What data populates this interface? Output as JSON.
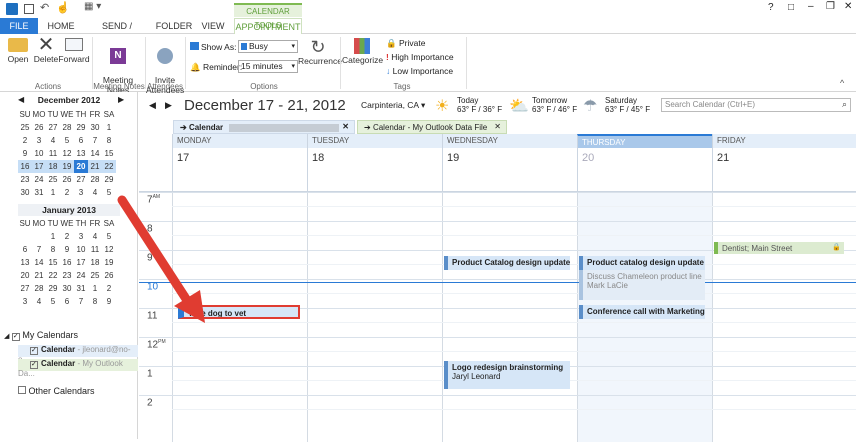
{
  "titlebar": {
    "controls": [
      "?",
      "□",
      "–",
      "❐",
      "✕"
    ]
  },
  "tabs": {
    "file": "FILE",
    "home": "HOME",
    "send_receive": "SEND / RECEIVE",
    "folder": "FOLDER",
    "view": "VIEW",
    "context": "CALENDAR TOOLS",
    "appointment": "APPOINTMENT"
  },
  "ribbon": {
    "open": "Open",
    "delete": "Delete",
    "forward": "Forward",
    "actions": "Actions",
    "meeting_notes": "Meeting\nNotes",
    "meeting_notes_group": "Meeting Notes",
    "invite": "Invite\nAttendees",
    "attendees": "Attendees",
    "show_as_label": "Show As:",
    "show_as_value": "Busy",
    "reminder_label": "Reminder:",
    "reminder_value": "15 minutes",
    "recurrence": "Recurrence",
    "options": "Options",
    "categorize": "Categorize",
    "private": "Private",
    "high": "High Importance",
    "low": "Low Importance",
    "tags": "Tags"
  },
  "mini1": {
    "title": "December 2012",
    "dow": [
      "SU",
      "MO",
      "TU",
      "WE",
      "TH",
      "FR",
      "SA"
    ],
    "rows": [
      [
        "25",
        "26",
        "27",
        "28",
        "29",
        "30",
        "1"
      ],
      [
        "2",
        "3",
        "4",
        "5",
        "6",
        "7",
        "8"
      ],
      [
        "9",
        "10",
        "11",
        "12",
        "13",
        "14",
        "15"
      ],
      [
        "16",
        "17",
        "18",
        "19",
        "20",
        "21",
        "22"
      ],
      [
        "23",
        "24",
        "25",
        "26",
        "27",
        "28",
        "29"
      ],
      [
        "30",
        "31",
        "1",
        "2",
        "3",
        "4",
        "5"
      ]
    ]
  },
  "mini2": {
    "title": "January 2013",
    "dow": [
      "SU",
      "MO",
      "TU",
      "WE",
      "TH",
      "FR",
      "SA"
    ],
    "rows": [
      [
        "",
        "",
        "1",
        "2",
        "3",
        "4",
        "5"
      ],
      [
        "6",
        "7",
        "8",
        "9",
        "10",
        "11",
        "12"
      ],
      [
        "13",
        "14",
        "15",
        "16",
        "17",
        "18",
        "19"
      ],
      [
        "20",
        "21",
        "22",
        "23",
        "24",
        "25",
        "26"
      ],
      [
        "27",
        "28",
        "29",
        "30",
        "31",
        "1",
        "2"
      ],
      [
        "3",
        "4",
        "5",
        "6",
        "7",
        "8",
        "9"
      ]
    ]
  },
  "folders": {
    "my_calendars": "My Calendars",
    "cal1": "Calendar",
    "cal1_sub": "- jleonard@no-o...",
    "cal2": "Calendar",
    "cal2_sub": "- My Outlook Da...",
    "other": "Other Calendars"
  },
  "header": {
    "range": "December 17 - 21, 2012",
    "location": "Carpinteria, CA",
    "today": "Today",
    "today_temp": "63° F / 36° F",
    "tomorrow": "Tomorrow",
    "tomorrow_temp": "63° F / 46° F",
    "saturday": "Saturday",
    "saturday_temp": "63° F / 45° F",
    "search_placeholder": "Search Calendar (Ctrl+E)"
  },
  "caltabs": {
    "tab1": "Calendar",
    "tab2": "Calendar - My Outlook Data File"
  },
  "days": [
    {
      "name": "MONDAY",
      "num": "17"
    },
    {
      "name": "TUESDAY",
      "num": "18"
    },
    {
      "name": "WEDNESDAY",
      "num": "19"
    },
    {
      "name": "THURSDAY",
      "num": "20"
    },
    {
      "name": "FRIDAY",
      "num": "21"
    }
  ],
  "hours": [
    {
      "h": "7",
      "ampm": "AM"
    },
    {
      "h": "8",
      "ampm": ""
    },
    {
      "h": "9",
      "ampm": ""
    },
    {
      "h": "10",
      "ampm": ""
    },
    {
      "h": "11",
      "ampm": ""
    },
    {
      "h": "12",
      "ampm": "PM"
    },
    {
      "h": "1",
      "ampm": ""
    },
    {
      "h": "2",
      "ampm": ""
    }
  ],
  "events": {
    "dentist": "Dentist; Main Street",
    "prod_wed": "Product Catalog design update meet",
    "prod_thu": "Product catalog design update meet",
    "chameleon": "Discuss Chameleon product line",
    "chameleon_who": "Mark LaCie",
    "dog": "Take dog to vet",
    "conf": "Conference call with Marketing",
    "logo": "Logo redesign brainstorming",
    "logo_who": "Jaryl Leonard"
  },
  "colors": {
    "accent": "#2a7ad5",
    "green": "#5f9e3a",
    "arrow": "#e03c31"
  }
}
